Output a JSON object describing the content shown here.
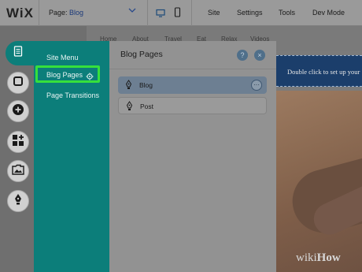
{
  "topbar": {
    "logo": "WiX",
    "page_prefix": "Page:",
    "page_name": "Blog",
    "menu": [
      "Site",
      "Settings",
      "Tools",
      "Dev Mode"
    ]
  },
  "site_nav": [
    "Home",
    "About",
    "Travel",
    "Eat",
    "Relax",
    "Videos"
  ],
  "canvas": {
    "banner_text": "Double click to set up your"
  },
  "teal_menu": {
    "items": [
      "Site Menu",
      "Blog Pages",
      "Page Transitions"
    ]
  },
  "blog_panel": {
    "title": "Blog Pages",
    "help": "?",
    "close": "×",
    "pages": [
      {
        "label": "Blog",
        "selected": true,
        "more": "···"
      },
      {
        "label": "Post",
        "selected": false
      }
    ]
  },
  "watermark": {
    "part1": "wiki",
    "part2": "How"
  },
  "colors": {
    "teal": "#0c7e7a",
    "highlight": "#36e03c",
    "banner": "#1b3e6b"
  },
  "icons": {
    "left_rail": [
      "pages-icon",
      "background-icon",
      "add-icon",
      "add-apps-icon",
      "media-icon",
      "blog-pen-icon"
    ]
  }
}
